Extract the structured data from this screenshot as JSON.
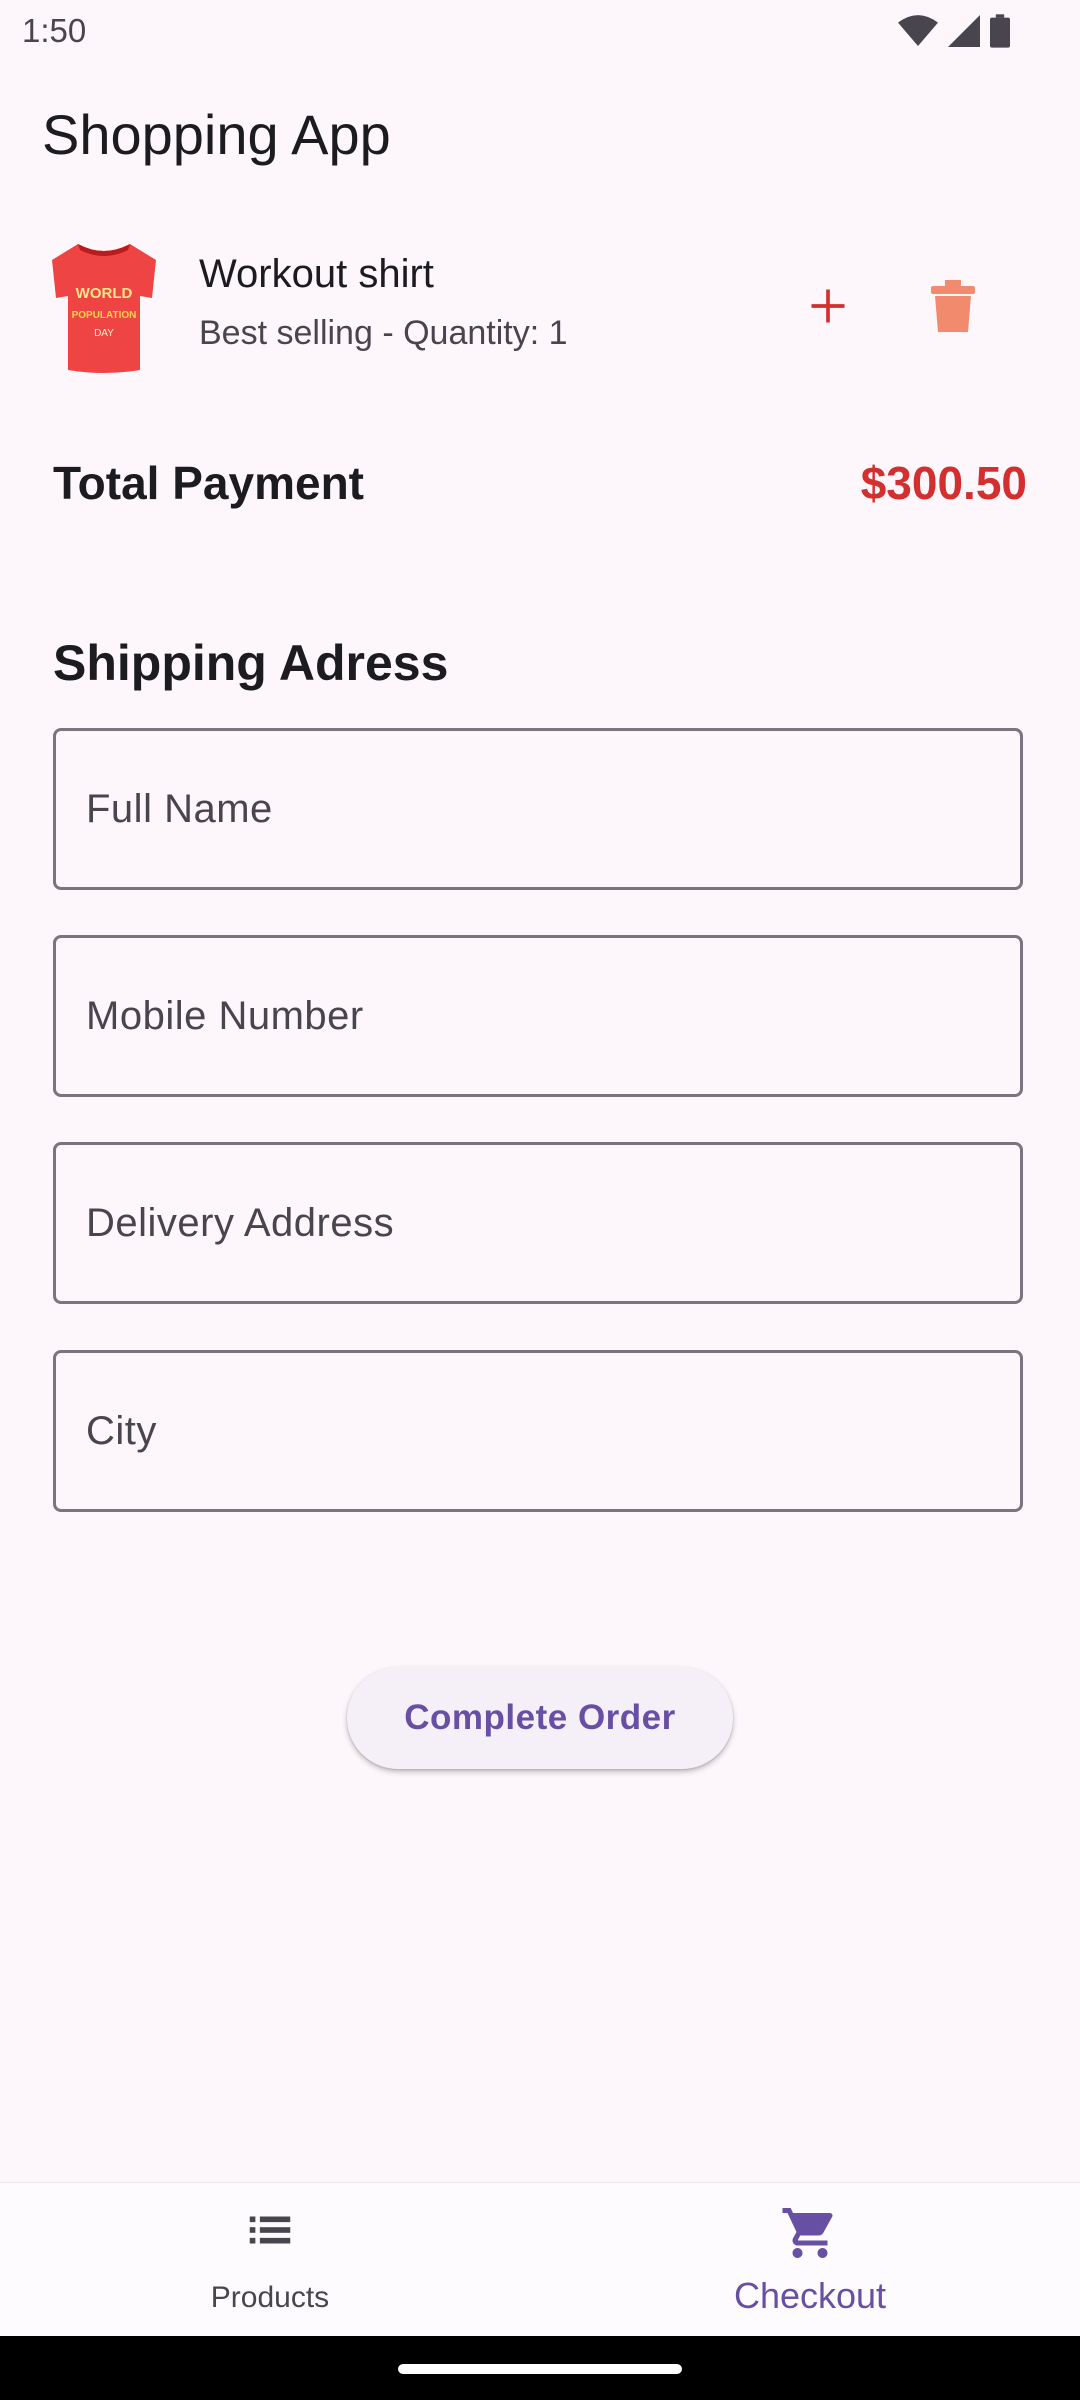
{
  "status_bar": {
    "time": "1:50"
  },
  "app_bar": {
    "title": "Shopping App"
  },
  "cart": {
    "items": [
      {
        "name": "Workout shirt",
        "subtitle": "Best selling - Quantity: 1",
        "image_icon": "t-shirt-icon",
        "shirt_print": [
          "WORLD",
          "POPULATION",
          "DAY"
        ]
      }
    ]
  },
  "total": {
    "label": "Total Payment",
    "value": "$300.50"
  },
  "shipping": {
    "title": "Shipping Adress",
    "fields": [
      {
        "placeholder": "Full Name",
        "value": ""
      },
      {
        "placeholder": "Mobile Number",
        "value": ""
      },
      {
        "placeholder": "Delivery Address",
        "value": ""
      },
      {
        "placeholder": "City",
        "value": ""
      }
    ]
  },
  "actions": {
    "complete_order": "Complete Order"
  },
  "nav": {
    "items": [
      {
        "label": "Products",
        "icon": "list-icon",
        "selected": false
      },
      {
        "label": "Checkout",
        "icon": "shopping-cart-icon",
        "selected": true
      }
    ]
  },
  "colors": {
    "accent": "#6750a4",
    "price": "#d32f2f",
    "add_icon": "#d32f2f",
    "delete_icon": "#f28b6e",
    "background": "#fdf7fc"
  }
}
